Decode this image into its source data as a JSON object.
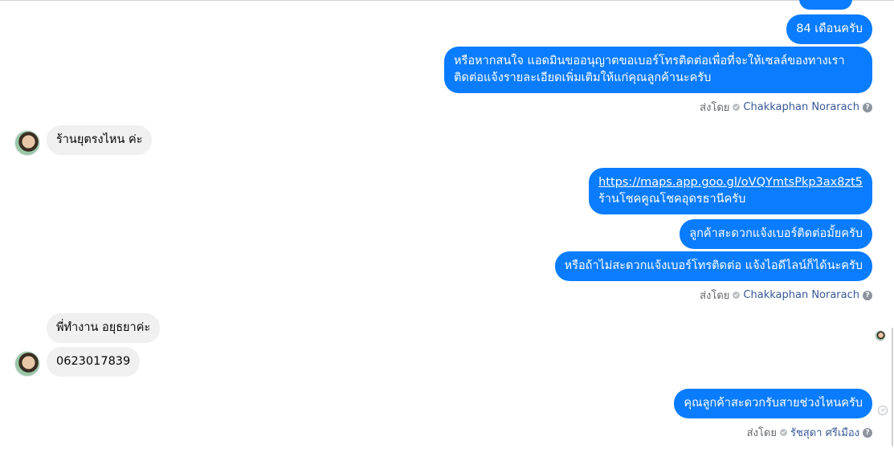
{
  "conversation": {
    "messages": [
      {
        "from": "agent",
        "text": "84 เดือนครับ"
      },
      {
        "from": "agent",
        "lines": [
          "หรือหากสนใจ แอดมินขออนุญาตขอเบอร์โทรติดต่อเพื่อที่จะให้เซลล์ของทางเรา",
          "ติดต่อแจ้งรายละเอียดเพิ่มเติมให้แก่คุณลูกค้านะครับ"
        ]
      },
      {
        "from": "customer",
        "text": "ร้านยุตรงไหน ค่ะ"
      },
      {
        "from": "agent",
        "link": "https://maps.app.goo.gl/oVQYmtsPkp3ax8zt5",
        "text": "ร้านโชคคูณโชคอุดรธานีครับ"
      },
      {
        "from": "agent",
        "text": "ลูกค้าสะดวกแจ้งเบอร์ติดต่อมั้ยครับ"
      },
      {
        "from": "agent",
        "text": "หรือถ้าไม่สะดวกแจ้งเบอร์โทรติดต่อ แจ้งไอดีไลน์ก็ได้นะครับ"
      },
      {
        "from": "customer",
        "text": "พี่ทำงาน อยุธยาค่ะ"
      },
      {
        "from": "customer",
        "text": "0623017839"
      },
      {
        "from": "agent",
        "text": "คุณลูกค้าสะดวกรับสายช่วงไหนครับ"
      }
    ],
    "sent_by": [
      {
        "prefix": "ส่งโดย",
        "name": "Chakkaphan Norarach"
      },
      {
        "prefix": "ส่งโดย",
        "name": "Chakkaphan Norarach"
      },
      {
        "prefix": "ส่งโดย",
        "name": "รัชสุดา ศรีเมือง"
      }
    ],
    "help_glyph": "?"
  },
  "colors": {
    "outgoing": "#0a7cff",
    "incoming": "#f0f0f0",
    "link": "#385898"
  },
  "icons": {
    "avatar": "customer-avatar",
    "seen": "seen-check-icon",
    "help": "help-circle-icon",
    "sent_check": "sent-check-icon"
  }
}
